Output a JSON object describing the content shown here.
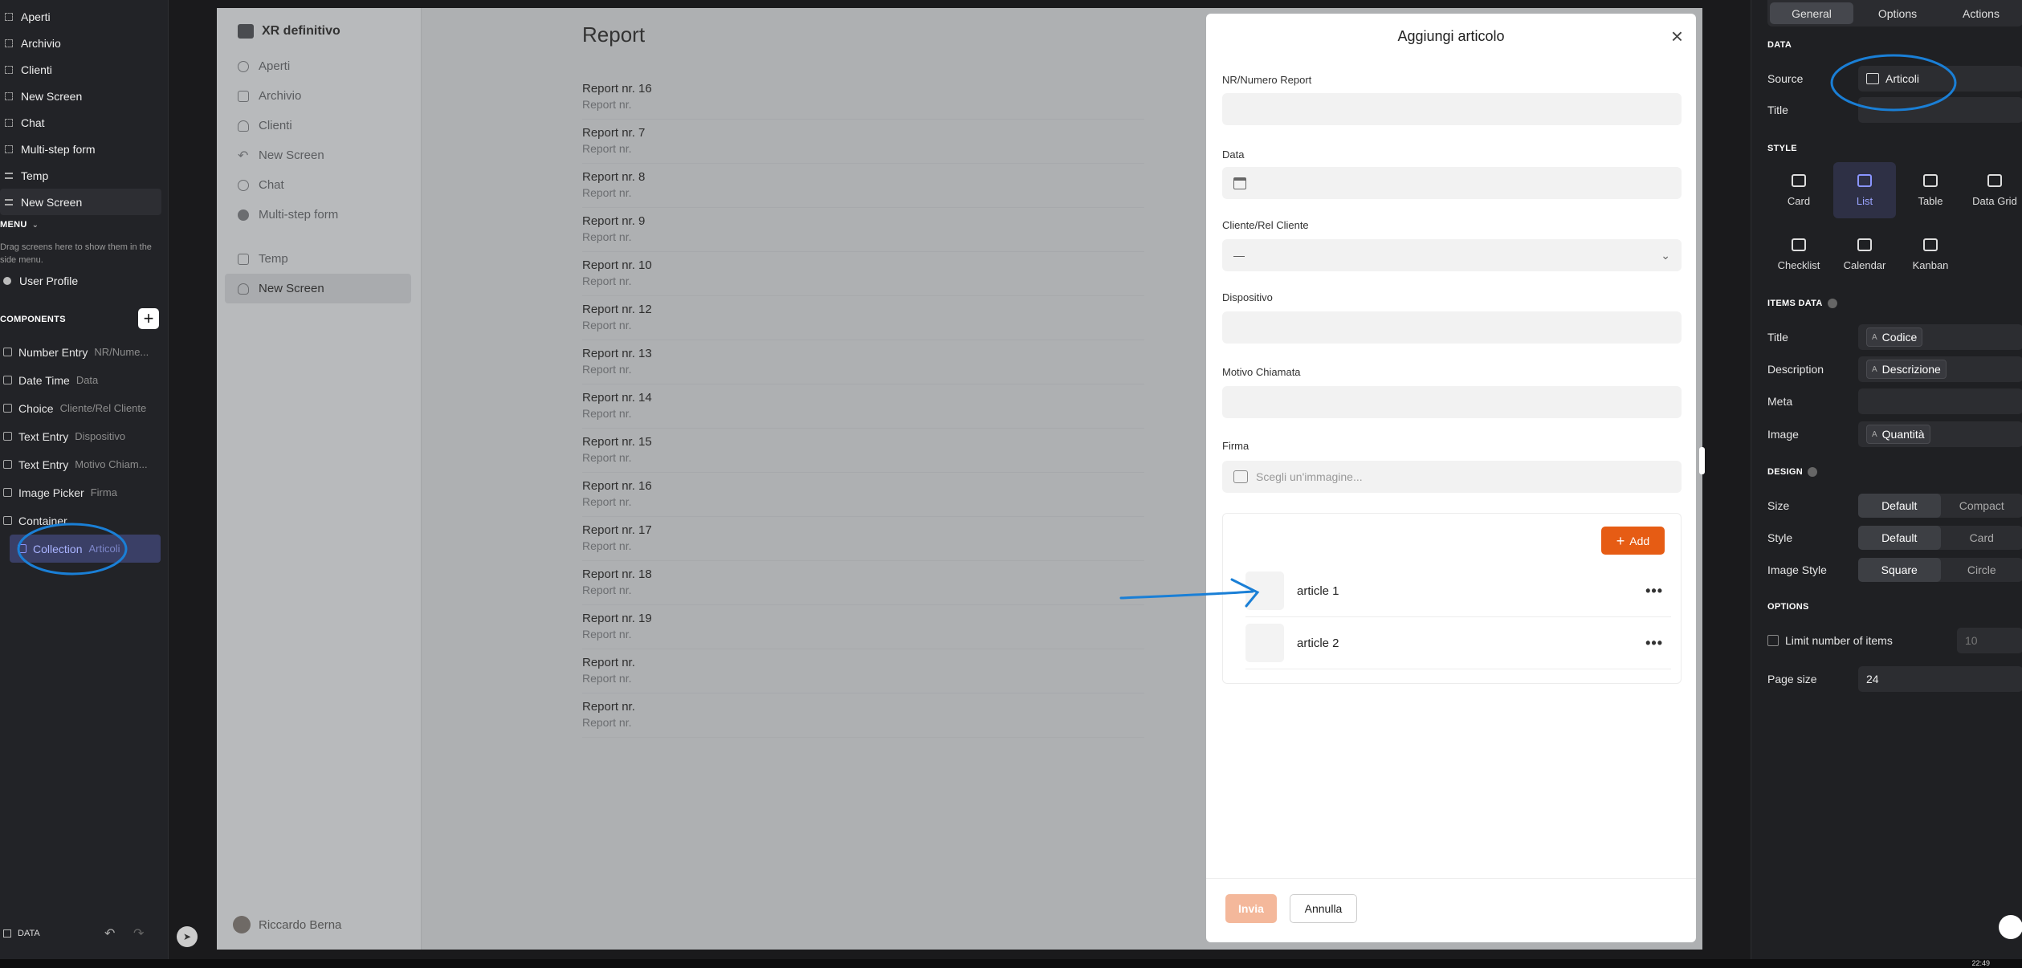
{
  "left_sidebar": {
    "screens": [
      {
        "label": "Aperti"
      },
      {
        "label": "Archivio"
      },
      {
        "label": "Clienti"
      },
      {
        "label": "New Screen"
      },
      {
        "label": "Chat"
      },
      {
        "label": "Multi-step form"
      },
      {
        "label": "Temp"
      },
      {
        "label": "New Screen"
      }
    ],
    "menu_header": "MENU",
    "menu_hint": "Drag screens here to show them in the side menu.",
    "user_profile": "User Profile",
    "components_header": "COMPONENTS",
    "components": [
      {
        "type": "Number Entry",
        "name": "NR/Nume..."
      },
      {
        "type": "Date Time",
        "name": "Data"
      },
      {
        "type": "Choice",
        "name": "Cliente/Rel Cliente"
      },
      {
        "type": "Text Entry",
        "name": "Dispositivo"
      },
      {
        "type": "Text Entry",
        "name": "Motivo Chiam..."
      },
      {
        "type": "Image Picker",
        "name": "Firma"
      },
      {
        "type": "Container",
        "name": ""
      },
      {
        "type": "Collection",
        "name": "Articoli"
      }
    ],
    "footer_label": "DATA"
  },
  "app": {
    "name": "XR definitivo",
    "nav": [
      {
        "label": "Aperti",
        "icon": "check-circle-icon"
      },
      {
        "label": "Archivio",
        "icon": "table-icon"
      },
      {
        "label": "Clienti",
        "icon": "user-icon"
      },
      {
        "label": "New Screen",
        "icon": "undo-icon"
      },
      {
        "label": "Chat",
        "icon": "chat-icon"
      },
      {
        "label": "Multi-step form",
        "icon": "smile-icon"
      },
      {
        "label": "Temp",
        "icon": "mail-icon"
      },
      {
        "label": "New Screen",
        "icon": "cloud-upload-icon"
      }
    ],
    "user": "Riccardo Berna",
    "report_title": "Report",
    "reports": [
      {
        "title": "Report nr. 16",
        "sub": "Report nr."
      },
      {
        "title": "Report nr. 7",
        "sub": "Report nr."
      },
      {
        "title": "Report nr. 8",
        "sub": "Report nr."
      },
      {
        "title": "Report nr. 9",
        "sub": "Report nr."
      },
      {
        "title": "Report nr. 10",
        "sub": "Report nr."
      },
      {
        "title": "Report nr. 12",
        "sub": "Report nr."
      },
      {
        "title": "Report nr. 13",
        "sub": "Report nr."
      },
      {
        "title": "Report nr. 14",
        "sub": "Report nr."
      },
      {
        "title": "Report nr. 15",
        "sub": "Report nr."
      },
      {
        "title": "Report nr. 16",
        "sub": "Report nr."
      },
      {
        "title": "Report nr. 17",
        "sub": "Report nr."
      },
      {
        "title": "Report nr. 18",
        "sub": "Report nr."
      },
      {
        "title": "Report nr. 19",
        "sub": "Report nr."
      },
      {
        "title": "Report nr.",
        "sub": "Report nr."
      },
      {
        "title": "Report nr.",
        "sub": "Report nr."
      }
    ]
  },
  "modal": {
    "title": "Aggiungi articolo",
    "close": "×",
    "fields": {
      "nr_label": "NR/Numero Report",
      "data_label": "Data",
      "cliente_label": "Cliente/Rel Cliente",
      "cliente_value": "—",
      "dispositivo_label": "Dispositivo",
      "motivo_label": "Motivo Chiamata",
      "firma_label": "Firma",
      "firma_placeholder": "Scegli un'immagine..."
    },
    "add_label": "Add",
    "articles": [
      {
        "label": "article 1"
      },
      {
        "label": "article 2"
      }
    ],
    "submit": "Invia",
    "cancel": "Annulla"
  },
  "right_panel": {
    "tabs": [
      "General",
      "Options",
      "Actions"
    ],
    "data_header": "DATA",
    "source_label": "Source",
    "source_value": "Articoli",
    "title_label": "Title",
    "style_header": "STYLE",
    "styles": [
      "Card",
      "List",
      "Table",
      "Data Grid",
      "Checklist",
      "Calendar",
      "Kanban"
    ],
    "items_header": "ITEMS DATA",
    "items": [
      {
        "label": "Title",
        "value": "Codice"
      },
      {
        "label": "Description",
        "value": "Descrizione"
      },
      {
        "label": "Meta",
        "value": ""
      },
      {
        "label": "Image",
        "value": "Quantità"
      }
    ],
    "design_header": "DESIGN",
    "design": [
      {
        "label": "Size",
        "options": [
          "Default",
          "Compact"
        ]
      },
      {
        "label": "Style",
        "options": [
          "Default",
          "Card"
        ]
      },
      {
        "label": "Image Style",
        "options": [
          "Square",
          "Circle"
        ]
      }
    ],
    "options_header": "OPTIONS",
    "limit_label": "Limit number of items",
    "limit_value": "10",
    "page_size_label": "Page size",
    "page_size_value": "24"
  },
  "taskbar": {
    "time": "22:49"
  },
  "colors": {
    "accent_orange": "#e65c14",
    "annotation_blue": "#1a7fd6",
    "selection_purple": "#8a95ff"
  }
}
